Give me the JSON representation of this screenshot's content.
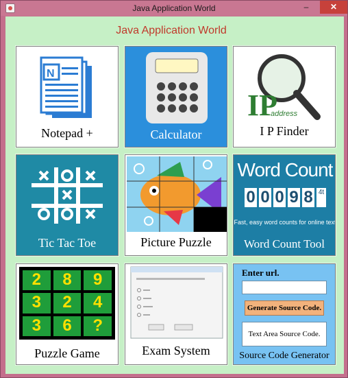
{
  "window": {
    "title": "Java Application World",
    "minimize": "–",
    "maximize": "□",
    "close": "✕"
  },
  "header": {
    "title": "Java Application World"
  },
  "tiles": [
    {
      "caption": "Notepad +"
    },
    {
      "caption": "Calculator"
    },
    {
      "caption": "I P Finder",
      "badge_main": "IP",
      "badge_sub": "address"
    },
    {
      "caption": "Tic Tac Toe"
    },
    {
      "caption": "Picture Puzzle"
    },
    {
      "caption": "Word Count Tool",
      "banner": "Word Count",
      "digits": [
        "0",
        "0",
        "0",
        "9",
        "8"
      ],
      "unit": "4t",
      "tagline": "Fast, easy word counts for online text"
    },
    {
      "caption": "Puzzle Game",
      "cells": [
        "2",
        "8",
        "9",
        "3",
        "2",
        "4",
        "3",
        "6",
        "?"
      ]
    },
    {
      "caption": "Exam System"
    },
    {
      "caption": "Source Code Generator",
      "url_label": "Enter url.",
      "generate_button": "Generate Source Code.",
      "textarea_label": "Text Area Source Code."
    }
  ],
  "colors": {
    "header_red": "#c0392b",
    "client_green": "#c6f0c6",
    "title_bar": "#c97792"
  }
}
